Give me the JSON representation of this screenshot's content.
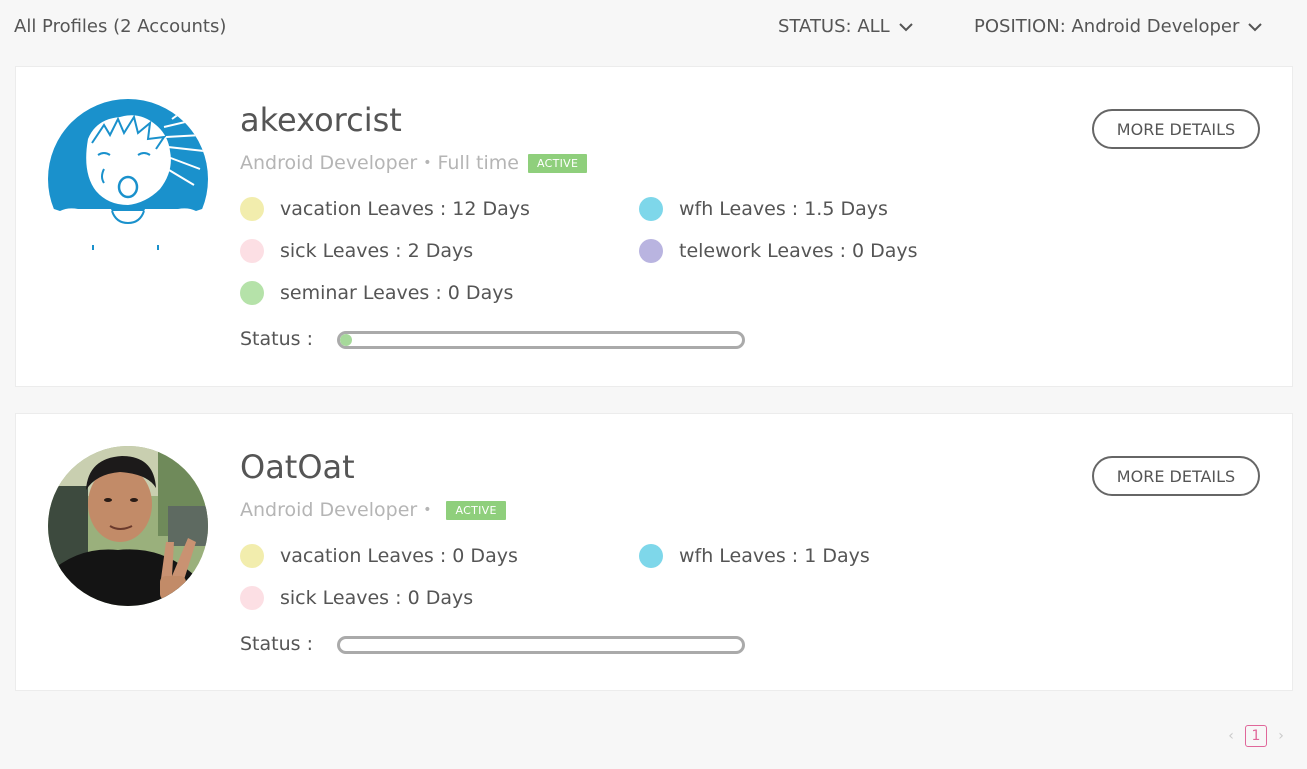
{
  "header": {
    "title": "All Profiles (2 Accounts)",
    "status_filter": "STATUS: ALL",
    "position_filter": "POSITION: Android Developer"
  },
  "colors": {
    "vacation": "#f2edad",
    "sick": "#fcdfe4",
    "seminar": "#b5e2a9",
    "wfh": "#7ed7ea",
    "telework": "#b9b4e0",
    "active_badge": "#8fcf7c",
    "pagination_accent": "#e0679a"
  },
  "profiles": [
    {
      "name": "akexorcist",
      "position": "Android Developer",
      "employment": "Full time",
      "badge": "ACTIVE",
      "more_label": "MORE DETAILS",
      "avatar": "cartoon-avatar-icon",
      "leaves": [
        {
          "label": "vacation Leaves : 12 Days",
          "type": "vacation"
        },
        {
          "label": "wfh Leaves : 1.5 Days",
          "type": "wfh"
        },
        {
          "label": "sick Leaves : 2 Days",
          "type": "sick"
        },
        {
          "label": "telework Leaves : 0 Days",
          "type": "telework"
        },
        {
          "label": "seminar Leaves : 0 Days",
          "type": "seminar"
        }
      ],
      "status_label": "Status :",
      "status_progress": 0.03
    },
    {
      "name": "OatOat",
      "position": "Android Developer",
      "badge": "ACTIVE",
      "more_label": "MORE DETAILS",
      "avatar": "photo-avatar",
      "leaves": [
        {
          "label": "vacation Leaves : 0 Days",
          "type": "vacation"
        },
        {
          "label": "wfh Leaves : 1 Days",
          "type": "wfh"
        },
        {
          "label": "sick Leaves : 0 Days",
          "type": "sick"
        }
      ],
      "status_label": "Status :",
      "status_progress": 0
    }
  ],
  "pagination": {
    "prev": "‹",
    "current": "1",
    "next": "›"
  }
}
